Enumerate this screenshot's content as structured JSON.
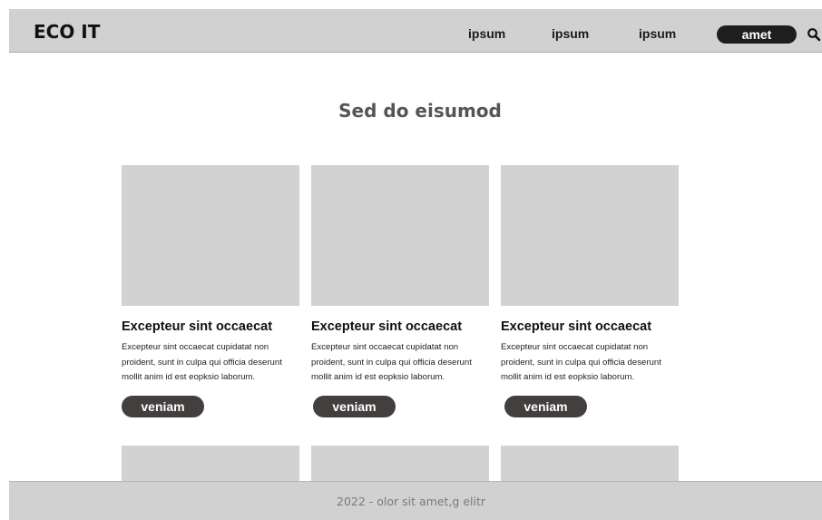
{
  "header": {
    "logo": "ECO IT",
    "nav": [
      "ipsum",
      "ipsum",
      "ipsum"
    ],
    "cta_label": "amet",
    "search_icon": "search-icon"
  },
  "main": {
    "title": "Sed do eisumod",
    "cards": [
      {
        "title": "Excepteur sint occaecat",
        "text": "Excepteur sint occaecat cupidatat non proident, sunt in culpa qui officia deserunt mollit anim id est eopksio laborum.",
        "button": "veniam"
      },
      {
        "title": "Excepteur sint occaecat",
        "text": "Excepteur sint occaecat cupidatat non proident, sunt in culpa qui officia deserunt mollit anim id est eopksio laborum.",
        "button": "veniam"
      },
      {
        "title": "Excepteur sint occaecat",
        "text": "Excepteur sint occaecat cupidatat non proident, sunt in culpa qui officia deserunt mollit anim id est eopksio laborum.",
        "button": "veniam"
      }
    ]
  },
  "footer": {
    "text": "2022 - olor sit amet,g elitr"
  },
  "colors": {
    "header_bg": "#d1d1d1",
    "placeholder": "#d2d2d2",
    "button_bg": "#433f3e",
    "cta_bg": "#1e1e1e"
  }
}
